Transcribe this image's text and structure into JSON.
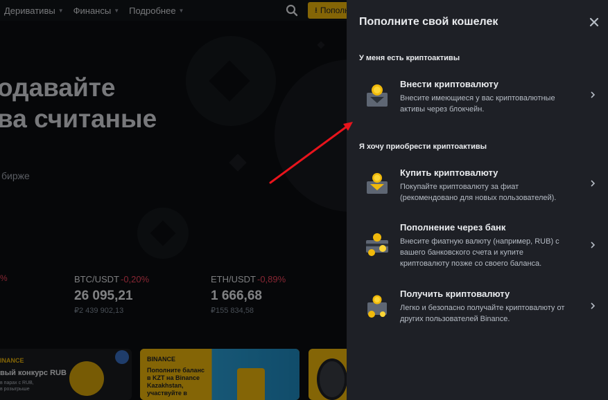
{
  "nav": {
    "items": [
      "Деривативы",
      "Финансы",
      "Подробнее"
    ],
    "deposit_label": "Пополн"
  },
  "hero": {
    "line1": "одавайте",
    "line2": "ва считаные",
    "sub": "бирже"
  },
  "tickers": {
    "left_pct": "%",
    "items": [
      {
        "pair": "BTC/USDT",
        "change": "-0,20%",
        "price": "26 095,21",
        "fiat": "₽2 439 902,13"
      },
      {
        "pair": "ETH/USDT",
        "change": "-0,89%",
        "price": "1 666,68",
        "fiat": "₽155 834,58"
      }
    ]
  },
  "banners": {
    "b1_logo": "INANCE",
    "b1_title": "вый конкурс RUB",
    "b1_small": "в парах с RUB,\nв розыгрыше",
    "b2_logo": "BINANCE",
    "b2_text": "Пополните баланс\nв KZT на Binance\nKazakhstan,\nучаствуйте в"
  },
  "drawer": {
    "title": "Пополните свой кошелек",
    "section1": "У меня есть криптоактивы",
    "section2": "Я хочу приобрести криптоактивы",
    "options": [
      {
        "title": "Внести криптовалюту",
        "desc": "Внесите имеющиеся у вас криптовалютные активы через блокчейн.",
        "icon": "wallet-coin-icon"
      },
      {
        "title": "Купить криптовалюту",
        "desc": "Покупайте криптовалюту за фиат (рекомендовано для новых пользователей).",
        "icon": "buy-crypto-icon"
      },
      {
        "title": "Пополнение через банк",
        "desc": "Внесите фиатную валюту (например, RUB) с вашего банковского счета и купите криптовалюту позже со своего баланса.",
        "icon": "bank-deposit-icon"
      },
      {
        "title": "Получить криптовалюту",
        "desc": "Легко и безопасно получайте криптовалюту от других пользователей Binance.",
        "icon": "receive-crypto-icon"
      }
    ]
  },
  "colors": {
    "accent": "#f0b90b",
    "negative": "#f6465d",
    "drawer_bg": "#1e2026",
    "annotation_arrow": "#e8141c"
  }
}
